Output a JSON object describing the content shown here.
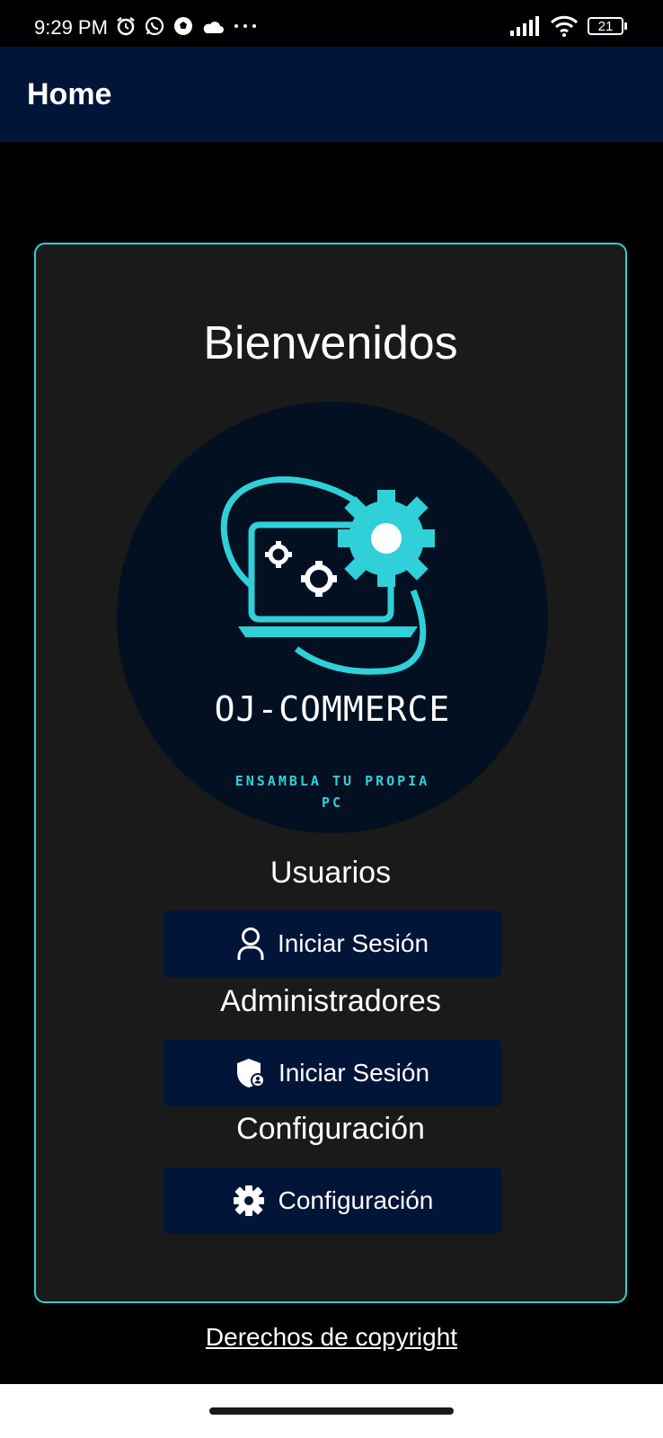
{
  "status_bar": {
    "time": "9:29 PM",
    "battery": "21",
    "icons_left": [
      "alarm-icon",
      "whatsapp-icon",
      "soccer-ball-icon",
      "cloud-icon",
      "more-dots-icon"
    ],
    "icons_right": [
      "signal-icon",
      "wifi-icon",
      "battery-icon"
    ]
  },
  "app_bar": {
    "title": "Home"
  },
  "card": {
    "welcome": "Bienvenidos",
    "logo": {
      "brand": "OJ-COMMERCE",
      "tagline_line1": "ENSAMBLA TU PROPIA",
      "tagline_line2": "PC"
    },
    "sections": {
      "users_label": "Usuarios",
      "users_button": "Iniciar Sesión",
      "admins_label": "Administradores",
      "admins_button": "Iniciar Sesión",
      "config_label": "Configuración",
      "config_button": "Configuración"
    }
  },
  "footer": {
    "copyright_link": "Derechos de copyright"
  },
  "colors": {
    "accent": "#2fd0d8",
    "app_bar": "#001538",
    "card_bg": "#1a1a1a",
    "background": "#000000"
  }
}
